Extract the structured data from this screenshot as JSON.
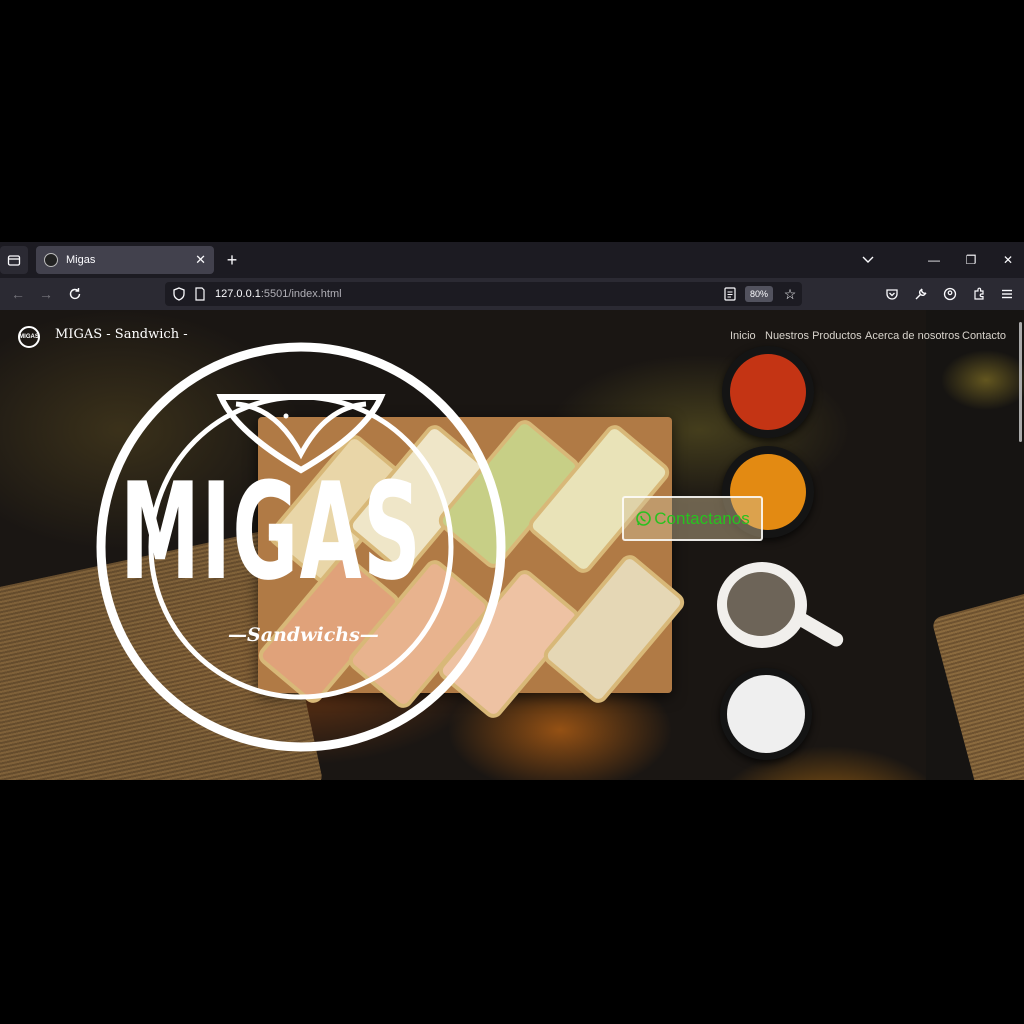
{
  "browser": {
    "tab_title": "Migas",
    "url_host": "127.0.0.1",
    "url_path": ":5501/index.html",
    "zoom": "80%"
  },
  "site": {
    "name": "MIGAS - Sandwich -",
    "logo_mark": "MIGAS",
    "nav": [
      "Inicio",
      "Nuestros Productos",
      "Acerca de nosotros",
      "Contacto"
    ]
  },
  "hero": {
    "brand": "MIGAS",
    "tagline": "—Sandwichs—",
    "contact_label": "Contactanos"
  },
  "colors": {
    "browser_bg": "#1c1b22",
    "contact_text": "#27c21f"
  }
}
